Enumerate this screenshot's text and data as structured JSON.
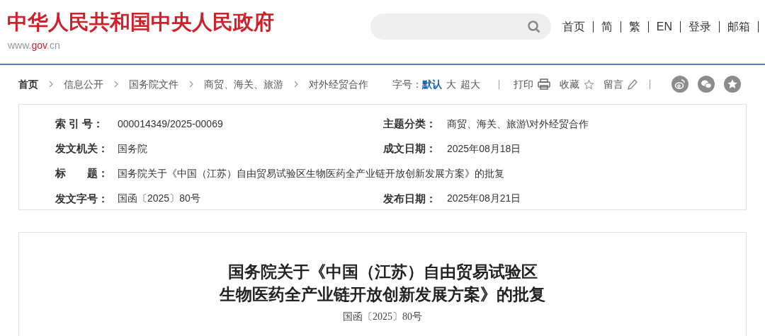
{
  "header": {
    "site_title": "中华人民共和国中央人民政府",
    "site_url_parts": [
      "www.",
      "gov",
      ".cn"
    ],
    "nav_links": [
      "首页",
      "简",
      "繁",
      "EN",
      "登录",
      "邮箱"
    ]
  },
  "breadcrumb": [
    "首页",
    "信息公开",
    "国务院文件",
    "商贸、海关、旅游",
    "对外经贸合作"
  ],
  "toolbar": {
    "font_size_label": "字号：",
    "font_sizes": [
      {
        "label": "默认",
        "selected": true
      },
      {
        "label": "大",
        "selected": false
      },
      {
        "label": "超大",
        "selected": false
      }
    ],
    "actions": [
      {
        "label": "打印",
        "kind": "print"
      },
      {
        "label": "收藏",
        "kind": "star"
      },
      {
        "label": "留言",
        "kind": "pencil"
      }
    ],
    "share": [
      {
        "kind": "weibo"
      },
      {
        "kind": "wechat"
      },
      {
        "kind": "favorite"
      }
    ]
  },
  "metadata": [
    {
      "label": "索 引 号：",
      "value": "000014349/2025-00069",
      "kind": "half"
    },
    {
      "label": "主题分类：",
      "value": "商贸、海关、旅游\\对外经贸合作",
      "kind": "half"
    },
    {
      "label": "发文机关：",
      "value": "国务院",
      "kind": "half"
    },
    {
      "label": "成文日期：",
      "value": "2025年08月18日",
      "kind": "half"
    },
    {
      "label": "标　　题：",
      "value": "国务院关于《中国（江苏）自由贸易试验区生物医药全产业链开放创新发展方案》的批复",
      "kind": "full"
    },
    {
      "label": "发文字号：",
      "value": "国函〔2025〕80号",
      "kind": "half"
    },
    {
      "label": "发布日期：",
      "value": "2025年08月21日",
      "kind": "half"
    }
  ],
  "document": {
    "title_lines": [
      "国务院关于《中国（江苏）自由贸易试验区",
      "生物医药全产业链开放创新发展方案》的批复"
    ],
    "doc_number": "国函〔2025〕80号"
  }
}
